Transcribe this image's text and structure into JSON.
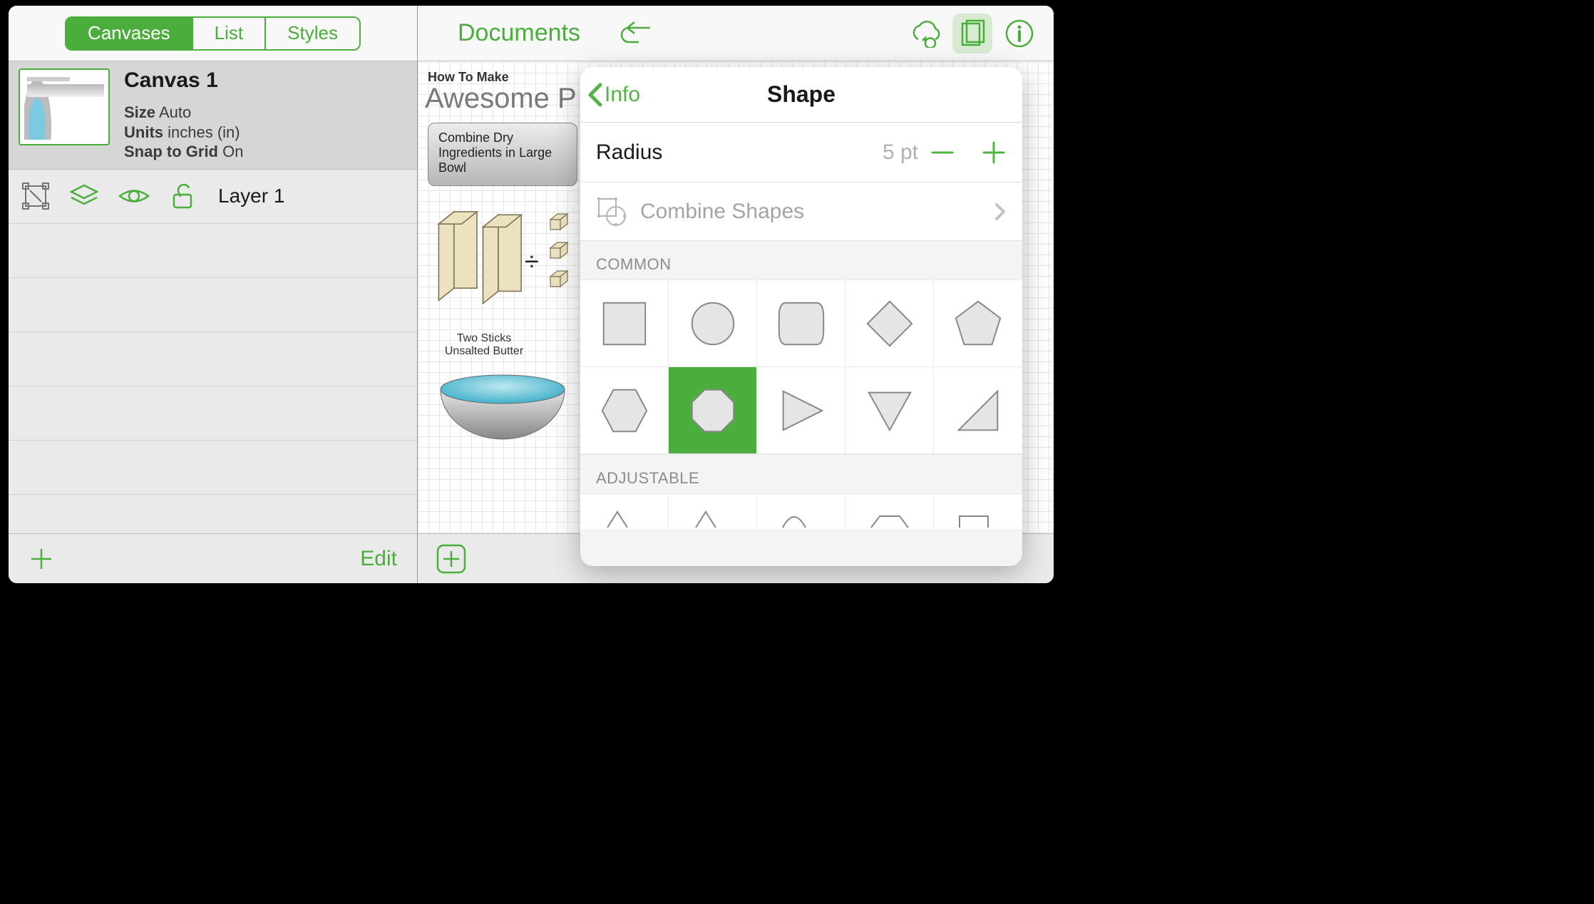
{
  "sidebar": {
    "segmented": {
      "canvases": "Canvases",
      "list": "List",
      "styles": "Styles",
      "active": "canvases"
    },
    "canvas": {
      "title": "Canvas 1",
      "size_label": "Size",
      "size_value": "Auto",
      "units_label": "Units",
      "units_value": "inches (in)",
      "snap_label": "Snap to Grid",
      "snap_value": "On"
    },
    "layer": {
      "name": "Layer 1"
    },
    "edit_label": "Edit"
  },
  "toolbar": {
    "documents": "Documents"
  },
  "document": {
    "subtitle": "How To Make",
    "title": "Awesome P",
    "step_text": "Combine Dry Ingredients in Large Bowl",
    "butter_l1": "Two Sticks",
    "butter_l2": "Unsalted Butter"
  },
  "popover": {
    "back_label": "Info",
    "title": "Shape",
    "radius_label": "Radius",
    "radius_value": "5 pt",
    "combine_label": "Combine Shapes",
    "section_common": "COMMON",
    "section_adjustable": "ADJUSTABLE",
    "shapes": [
      "rectangle",
      "circle",
      "rounded-rect",
      "diamond",
      "pentagon",
      "hexagon",
      "octagon",
      "play-triangle",
      "down-triangle",
      "right-triangle"
    ],
    "selected_shape": "octagon"
  }
}
